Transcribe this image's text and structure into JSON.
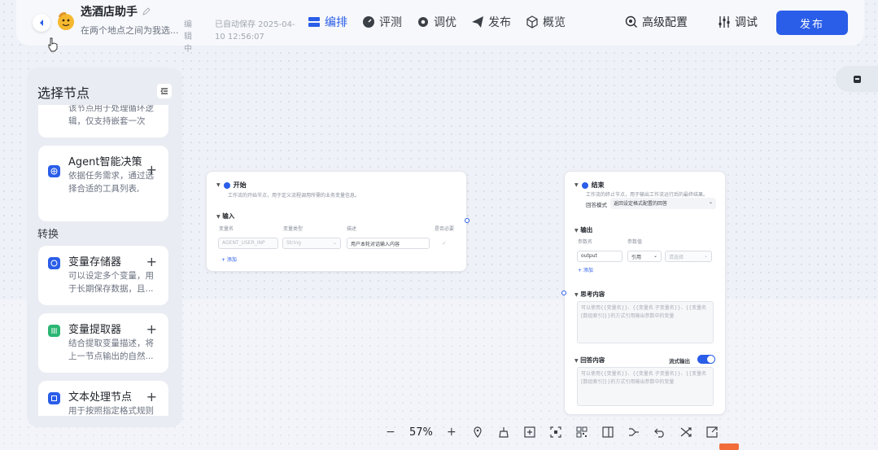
{
  "header": {
    "app_title": "选酒店助手",
    "app_desc": "在两个地点之间为我选...",
    "status_edit": "编辑中",
    "autosave": "已自动保存 2025-04-10 12:56:07",
    "nav": [
      {
        "label": "编排",
        "icon": "layout-icon",
        "active": true
      },
      {
        "label": "评测",
        "icon": "gauge-icon",
        "active": false
      },
      {
        "label": "调优",
        "icon": "gear-icon",
        "active": false
      },
      {
        "label": "发布",
        "icon": "send-icon",
        "active": false
      },
      {
        "label": "概览",
        "icon": "cube-icon",
        "active": false
      }
    ],
    "advanced_config": "高级配置",
    "debug": "调试",
    "publish": "发布"
  },
  "panel": {
    "title": "选择节点",
    "cards": [
      {
        "name": "",
        "desc": "该节点用于处理循环逻辑，仅支持嵌套一次"
      },
      {
        "name": "Agent智能决策",
        "desc": "依据任务需求，通过选择合适的工具列表,"
      },
      {
        "name": "变量存储器",
        "desc": "可以设定多个变量，用于长期保存数据，且..."
      },
      {
        "name": "变量提取器",
        "desc": "结合提取变量描述，将上一节点输出的自然..."
      },
      {
        "name": "文本处理节点",
        "desc": "用于按照指定格式规则"
      }
    ],
    "section_convert": "转换",
    "add_symbol": "+"
  },
  "start_node": {
    "title": "开始",
    "desc": "工作流的开始节点，用于定义流程调用所需的业务变量信息。",
    "input_label": "输入",
    "cols": [
      "变量名",
      "变量类型",
      "描述",
      "是否必要"
    ],
    "row": {
      "var": "AGENT_USER_INP",
      "type": "String",
      "desc": "用户本轮对话输入内容"
    },
    "add": "+ 添加"
  },
  "end_node": {
    "title": "结束",
    "desc": "工作流的终止节点，用于输出工作流运行后的最终结果。",
    "reply_mode_label": "回答模式",
    "reply_mode_value": "返回设定格式配置的回答",
    "output_label": "输出",
    "param_name_label": "参数名",
    "param_value_label": "参数值",
    "param_name": "output",
    "param_ref": "引用",
    "param_placeholder": "请选择",
    "add": "+ 添加",
    "think_label": "思考内容",
    "think_placeholder": "可以使用{{变量名}}、{{变量名.子变量名}}、{{变量名[数组索引]}}的方式引用输出参数中的变量",
    "answer_label": "回答内容",
    "stream_label": "流式输出",
    "answer_placeholder": "可以使用{{变量名}}、{{变量名.子变量名}}、{{变量名[数组索引]}}的方式引用输出参数中的变量"
  },
  "toolbar": {
    "zoom": "57%"
  },
  "colors": {
    "accent": "#2a5de8",
    "green": "#2bb673"
  }
}
